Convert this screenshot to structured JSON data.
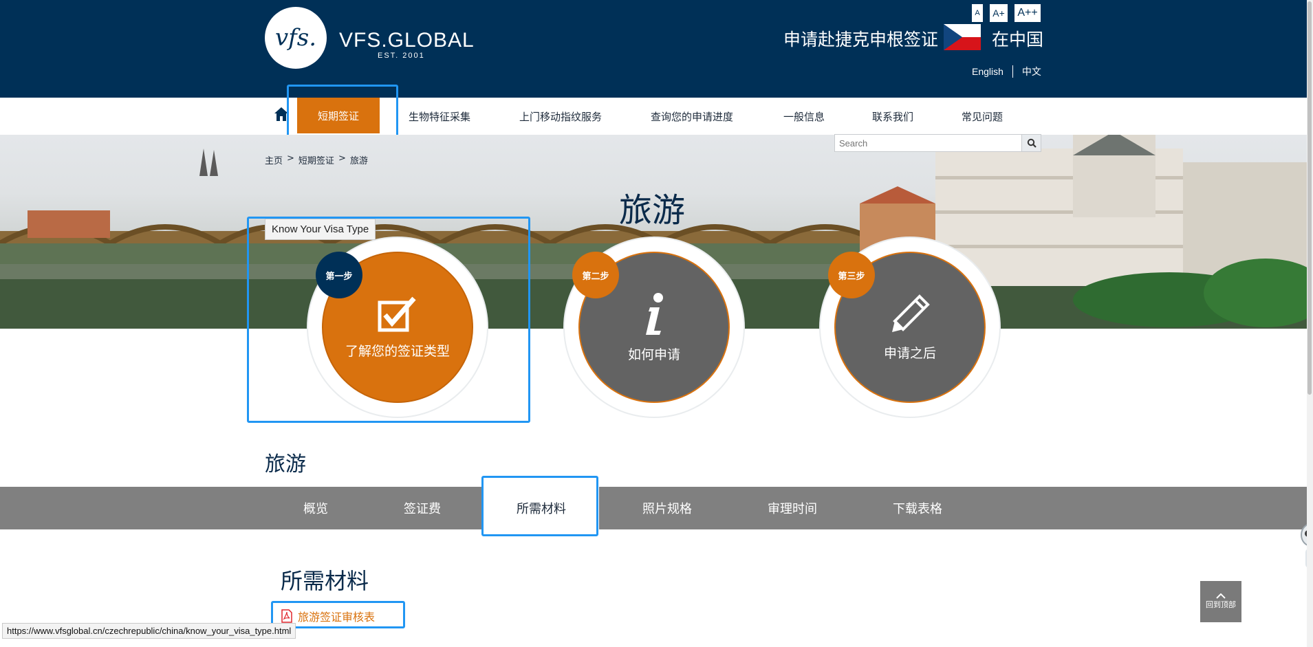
{
  "header": {
    "logo_mark": "vfs.",
    "logo_name": "VFS.GLOBAL",
    "logo_est": "EST. 2001",
    "font_size_buttons": [
      "A",
      "A+",
      "A++"
    ],
    "apply_title": "申请赴捷克申根签证",
    "location": "在中国",
    "languages": [
      "English",
      "中文"
    ],
    "colors": {
      "navy": "#003057",
      "orange": "#d9720e"
    }
  },
  "nav": {
    "items": [
      "短期签证",
      "生物特征采集",
      "上门移动指纹服务",
      "查询您的申请进度",
      "一般信息",
      "联系我们",
      "常见问题"
    ]
  },
  "search": {
    "placeholder": "Search"
  },
  "breadcrumb": [
    "主页",
    ">",
    "短期签证",
    ">",
    "旅游"
  ],
  "page_title": "旅游",
  "tooltip": "Know Your Visa Type",
  "steps": [
    {
      "badge": "第一步",
      "label": "了解您的签证类型",
      "icon": "checkbox-icon"
    },
    {
      "badge": "第二步",
      "label": "如何申请",
      "icon": "info-icon"
    },
    {
      "badge": "第三步",
      "label": "申请之后",
      "icon": "pencil-icon"
    }
  ],
  "section_title": "旅游",
  "tabs": [
    "概览",
    "签证费",
    "所需材料",
    "照片规格",
    "审理时间",
    "下载表格"
  ],
  "content": {
    "title": "所需材料",
    "pdf_link": "旅游签证审核表"
  },
  "status_url": "https://www.vfsglobal.cn/czechrepublic/china/know_your_visa_type.html",
  "back_to_top": "回到顶部"
}
